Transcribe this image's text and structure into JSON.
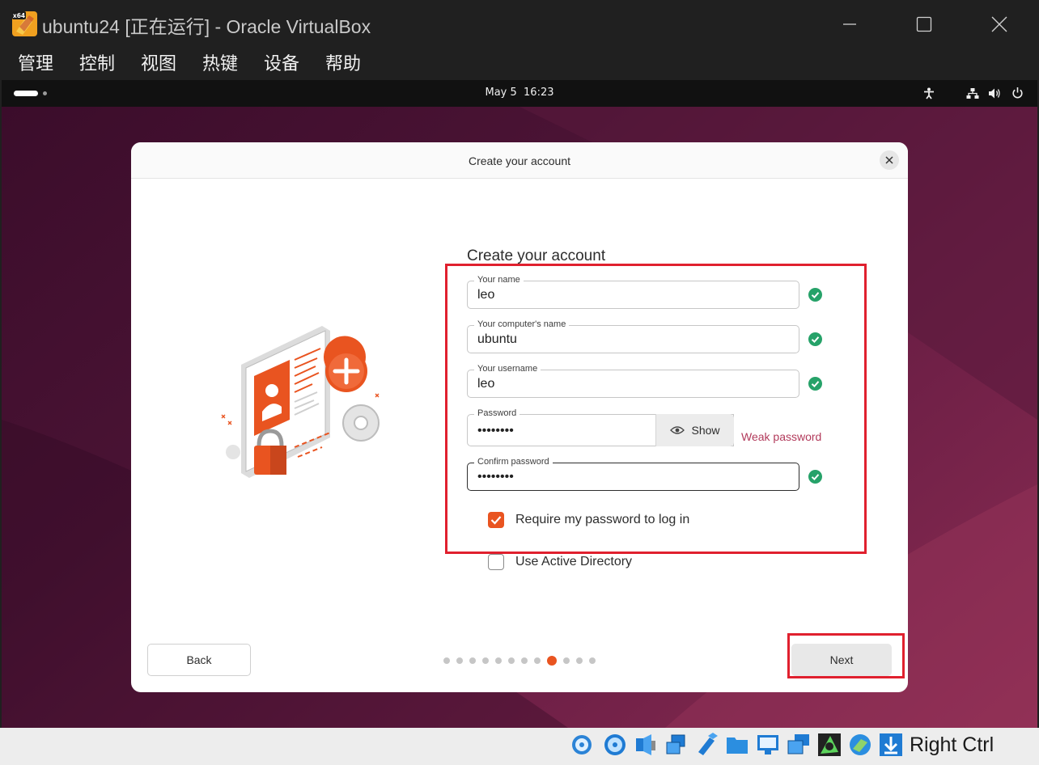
{
  "window": {
    "title": "ubuntu24 [正在运行] - Oracle VirtualBox",
    "app_icon": "virtualbox-x64-icon",
    "app_icon_badge": "x64",
    "controls": [
      "minimize-icon",
      "maximize-icon",
      "close-icon"
    ]
  },
  "menu": {
    "items": [
      "管理",
      "控制",
      "视图",
      "热键",
      "设备",
      "帮助"
    ]
  },
  "topbar": {
    "clock": "May 5  16:23",
    "icons": [
      "accessibility-icon",
      "network-icon",
      "volume-icon",
      "power-icon"
    ]
  },
  "dialog": {
    "header_title": "Create your account",
    "form_title": "Create your account",
    "fields": {
      "name": {
        "label": "Your name",
        "value": "leo",
        "valid": true
      },
      "computer": {
        "label": "Your computer's name",
        "value": "ubuntu",
        "valid": true
      },
      "username": {
        "label": "Your username",
        "value": "leo",
        "valid": true
      },
      "password": {
        "label": "Password",
        "value": "••••••••",
        "show_label": "Show",
        "strength": "Weak password"
      },
      "confirm": {
        "label": "Confirm password",
        "value": "••••••••",
        "valid": true
      }
    },
    "require_password": {
      "label": "Require my password to log in",
      "checked": true
    },
    "active_directory": {
      "label": "Use Active Directory",
      "checked": false
    },
    "back_label": "Back",
    "next_label": "Next",
    "pager": {
      "total": 12,
      "current": 9
    }
  },
  "colors": {
    "accent": "#e95420",
    "valid": "#26a269",
    "weak": "#b23a5b",
    "highlight": "#e0202e"
  },
  "statusbar": {
    "icons": [
      "hard-disk-icon",
      "optical-drive-icon",
      "audio-icon",
      "network-adapter-icon",
      "usb-icon",
      "shared-folders-icon",
      "display-icon",
      "video-capture-icon",
      "guest-additions-icon",
      "drag-and-drop-icon",
      "arrow-down-icon"
    ],
    "host_key": "Right Ctrl"
  }
}
